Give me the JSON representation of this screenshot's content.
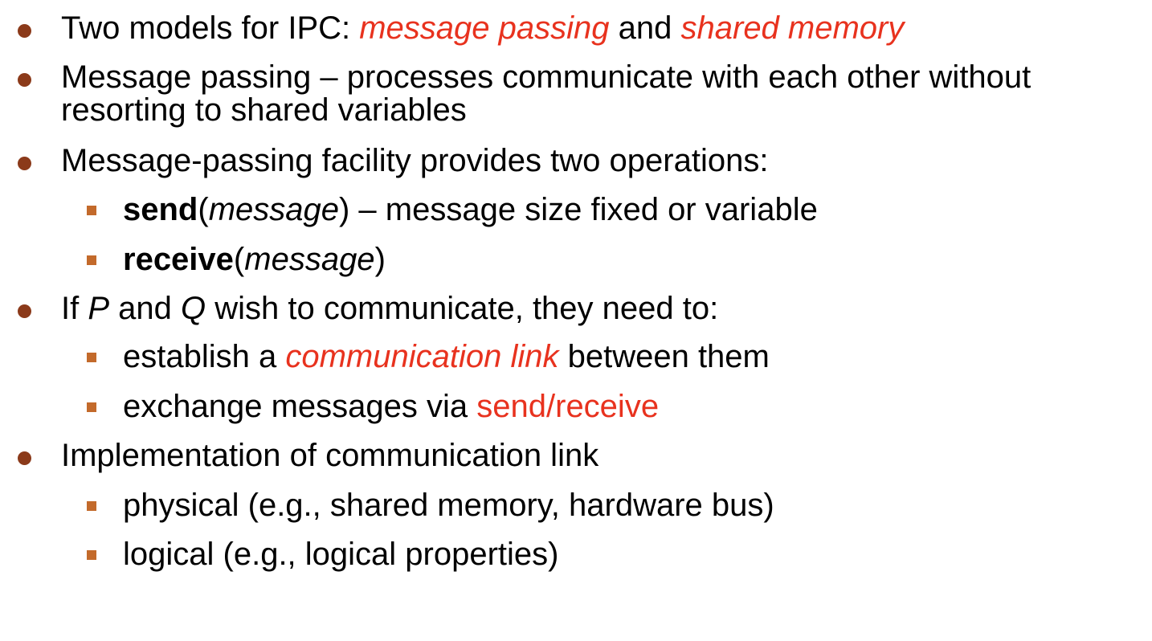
{
  "colors": {
    "bullet": "#8B3A1A",
    "sub_bullet": "#C36A2B",
    "highlight": "#E8321E"
  },
  "bullets": [
    {
      "parts": [
        "Two models for IPC: ",
        "message passing",
        " and ",
        "shared memory"
      ]
    },
    {
      "line1": "Message passing – processes communicate with each other without",
      "line2": "resorting to shared variables"
    },
    {
      "text": "Message-passing facility provides two operations:",
      "subs": [
        {
          "bold": "send",
          "open": "(",
          "italic": "message",
          "rest": ") – message size fixed or variable"
        },
        {
          "bold": "receive",
          "open": "(",
          "italic": "message",
          "rest": ")"
        }
      ]
    },
    {
      "parts": [
        "If ",
        "P",
        " and ",
        "Q",
        " wish to communicate, they need to:"
      ],
      "subs": [
        {
          "parts": [
            "establish a ",
            "communication link",
            " between them"
          ]
        },
        {
          "parts": [
            "exchange messages via ",
            "send/receive"
          ]
        }
      ]
    },
    {
      "text": "Implementation of communication link",
      "subs": [
        {
          "text": "physical (e.g., shared memory, hardware bus)"
        },
        {
          "text": "logical (e.g., logical properties)"
        }
      ]
    }
  ]
}
